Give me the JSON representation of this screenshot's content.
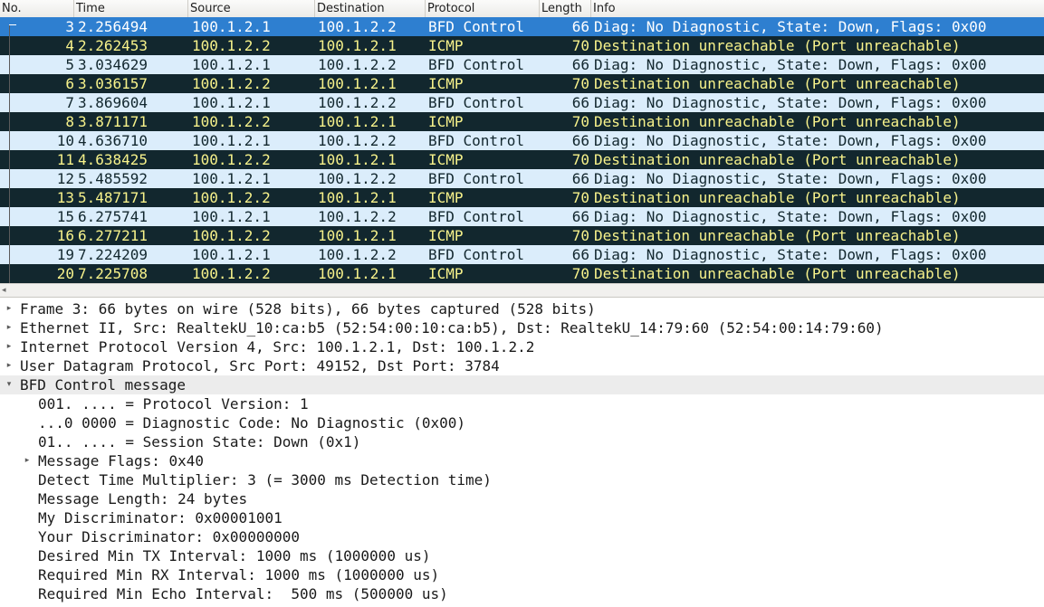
{
  "columns": {
    "no": "No.",
    "time": "Time",
    "source": "Source",
    "destination": "Destination",
    "protocol": "Protocol",
    "length": "Length",
    "info": "Info"
  },
  "colors": {
    "bfd_row_bg": "#dbedfb",
    "icmp_row_bg": "#12272e",
    "icmp_row_fg": "#f7f28b",
    "selected_row_bg": "#2e7fd0"
  },
  "packets": [
    {
      "no": "3",
      "time": "2.256494",
      "src": "100.1.2.1",
      "dst": "100.1.2.2",
      "proto": "BFD Control",
      "len": "66",
      "info": "Diag: No Diagnostic, State: Down, Flags: 0x00",
      "type": "sel"
    },
    {
      "no": "4",
      "time": "2.262453",
      "src": "100.1.2.2",
      "dst": "100.1.2.1",
      "proto": "ICMP",
      "len": "70",
      "info": "Destination unreachable (Port unreachable)",
      "type": "icmp"
    },
    {
      "no": "5",
      "time": "3.034629",
      "src": "100.1.2.1",
      "dst": "100.1.2.2",
      "proto": "BFD Control",
      "len": "66",
      "info": "Diag: No Diagnostic, State: Down, Flags: 0x00",
      "type": "bfd"
    },
    {
      "no": "6",
      "time": "3.036157",
      "src": "100.1.2.2",
      "dst": "100.1.2.1",
      "proto": "ICMP",
      "len": "70",
      "info": "Destination unreachable (Port unreachable)",
      "type": "icmp"
    },
    {
      "no": "7",
      "time": "3.869604",
      "src": "100.1.2.1",
      "dst": "100.1.2.2",
      "proto": "BFD Control",
      "len": "66",
      "info": "Diag: No Diagnostic, State: Down, Flags: 0x00",
      "type": "bfd"
    },
    {
      "no": "8",
      "time": "3.871171",
      "src": "100.1.2.2",
      "dst": "100.1.2.1",
      "proto": "ICMP",
      "len": "70",
      "info": "Destination unreachable (Port unreachable)",
      "type": "icmp"
    },
    {
      "no": "10",
      "time": "4.636710",
      "src": "100.1.2.1",
      "dst": "100.1.2.2",
      "proto": "BFD Control",
      "len": "66",
      "info": "Diag: No Diagnostic, State: Down, Flags: 0x00",
      "type": "bfd"
    },
    {
      "no": "11",
      "time": "4.638425",
      "src": "100.1.2.2",
      "dst": "100.1.2.1",
      "proto": "ICMP",
      "len": "70",
      "info": "Destination unreachable (Port unreachable)",
      "type": "icmp"
    },
    {
      "no": "12",
      "time": "5.485592",
      "src": "100.1.2.1",
      "dst": "100.1.2.2",
      "proto": "BFD Control",
      "len": "66",
      "info": "Diag: No Diagnostic, State: Down, Flags: 0x00",
      "type": "bfd"
    },
    {
      "no": "13",
      "time": "5.487171",
      "src": "100.1.2.2",
      "dst": "100.1.2.1",
      "proto": "ICMP",
      "len": "70",
      "info": "Destination unreachable (Port unreachable)",
      "type": "icmp"
    },
    {
      "no": "15",
      "time": "6.275741",
      "src": "100.1.2.1",
      "dst": "100.1.2.2",
      "proto": "BFD Control",
      "len": "66",
      "info": "Diag: No Diagnostic, State: Down, Flags: 0x00",
      "type": "bfd"
    },
    {
      "no": "16",
      "time": "6.277211",
      "src": "100.1.2.2",
      "dst": "100.1.2.1",
      "proto": "ICMP",
      "len": "70",
      "info": "Destination unreachable (Port unreachable)",
      "type": "icmp"
    },
    {
      "no": "19",
      "time": "7.224209",
      "src": "100.1.2.1",
      "dst": "100.1.2.2",
      "proto": "BFD Control",
      "len": "66",
      "info": "Diag: No Diagnostic, State: Down, Flags: 0x00",
      "type": "bfd"
    },
    {
      "no": "20",
      "time": "7.225708",
      "src": "100.1.2.2",
      "dst": "100.1.2.1",
      "proto": "ICMP",
      "len": "70",
      "info": "Destination unreachable (Port unreachable)",
      "type": "icmp"
    }
  ],
  "details": [
    {
      "text": "Frame 3: 66 bytes on wire (528 bits), 66 bytes captured (528 bits)",
      "level": 0,
      "expander": "collapsed",
      "icon": "triangle-right-icon"
    },
    {
      "text": "Ethernet II, Src: RealtekU_10:ca:b5 (52:54:00:10:ca:b5), Dst: RealtekU_14:79:60 (52:54:00:14:79:60)",
      "level": 0,
      "expander": "collapsed",
      "icon": "triangle-right-icon"
    },
    {
      "text": "Internet Protocol Version 4, Src: 100.1.2.1, Dst: 100.1.2.2",
      "level": 0,
      "expander": "collapsed",
      "icon": "triangle-right-icon"
    },
    {
      "text": "User Datagram Protocol, Src Port: 49152, Dst Port: 3784",
      "level": 0,
      "expander": "collapsed",
      "icon": "triangle-right-icon"
    },
    {
      "text": "BFD Control message",
      "level": 0,
      "expander": "expanded",
      "icon": "triangle-down-icon"
    },
    {
      "text": "001. .... = Protocol Version: 1",
      "level": 1,
      "expander": "none"
    },
    {
      "text": "...0 0000 = Diagnostic Code: No Diagnostic (0x00)",
      "level": 1,
      "expander": "none"
    },
    {
      "text": "01.. .... = Session State: Down (0x1)",
      "level": 1,
      "expander": "none"
    },
    {
      "text": "Message Flags: 0x40",
      "level": 1,
      "expander": "collapsed",
      "icon": "triangle-right-icon"
    },
    {
      "text": "Detect Time Multiplier: 3 (= 3000 ms Detection time)",
      "level": 1,
      "expander": "none"
    },
    {
      "text": "Message Length: 24 bytes",
      "level": 1,
      "expander": "none"
    },
    {
      "text": "My Discriminator: 0x00001001",
      "level": 1,
      "expander": "none"
    },
    {
      "text": "Your Discriminator: 0x00000000",
      "level": 1,
      "expander": "none"
    },
    {
      "text": "Desired Min TX Interval: 1000 ms (1000000 us)",
      "level": 1,
      "expander": "none"
    },
    {
      "text": "Required Min RX Interval: 1000 ms (1000000 us)",
      "level": 1,
      "expander": "none"
    },
    {
      "text": "Required Min Echo Interval:  500 ms (500000 us)",
      "level": 1,
      "expander": "none"
    }
  ],
  "scrollbar": {
    "left_arrow_icon": "arrow-left-icon"
  }
}
